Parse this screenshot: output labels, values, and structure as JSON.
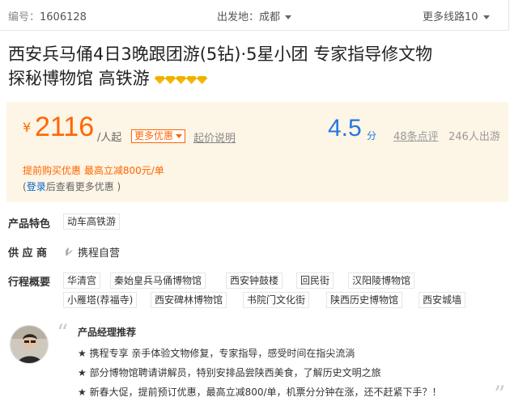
{
  "topbar": {
    "code_label": "编号：",
    "code_value": "1606128",
    "depart": "出发地：成都",
    "more_routes": "更多线路10"
  },
  "product": {
    "title_line1": "西安兵马俑4日3晚跟团游(5钻)·5星小团 专家指导修文物",
    "title_line2": "探秘博物馆 高铁游",
    "diamond_count": 5,
    "diamond_icon": "diamond-icon"
  },
  "price": {
    "currency": "¥",
    "value": "2116",
    "unit": "/人起",
    "more_discount": "更多优惠",
    "explain": "起价说明",
    "score": "4.5",
    "score_unit": "分",
    "reviews": "48条点评",
    "travelers": "246人出游",
    "promo": "提前购买优惠 最高立减800元/单",
    "login_prefix": "(",
    "login_link": "登录",
    "login_suffix": "后查看更多优惠 )"
  },
  "features": {
    "label": "产品特色",
    "tag": "动车高铁游"
  },
  "supplier": {
    "label": "供 应 商",
    "name": "携程自营",
    "icon": "ctrip-leaf-icon"
  },
  "itinerary": {
    "label": "行程概要",
    "row1": [
      "华清宫",
      "秦始皇兵马俑博物馆",
      "西安钟鼓楼",
      "回民街",
      "汉阳陵博物馆"
    ],
    "row2": [
      "小雁塔(荐福寺)",
      "西安碑林博物馆",
      "书院门文化街",
      "陕西历史博物馆",
      "西安城墙"
    ]
  },
  "manager": {
    "title": "产品经理推荐",
    "lines": [
      "★ 携程专享 亲手体验文物修复，专家指导，感受时间在指尖流淌",
      "★ 部分博物馆聘请讲解员，特别安排品尝陕西美食，了解历史文明之旅",
      "★ 新春大促，提前预订优惠，最高立减800/单，机票分分钟在涨，还不赶紧下手？！"
    ]
  },
  "colors": {
    "accent": "#ff6600",
    "score": "#2577e3",
    "price_bg": "#fdf5e6",
    "link": "#0066cc"
  }
}
